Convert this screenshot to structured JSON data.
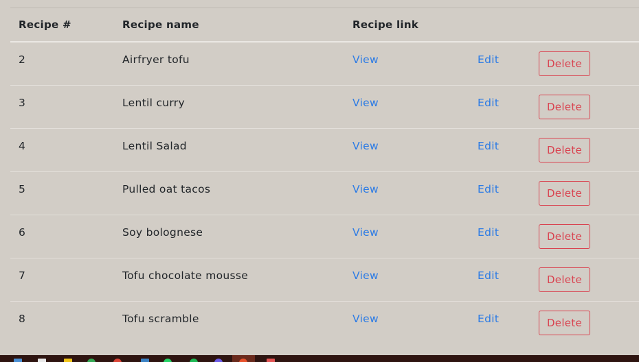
{
  "table": {
    "headers": {
      "number": "Recipe #",
      "name": "Recipe name",
      "link": "Recipe link"
    },
    "rows": [
      {
        "number": "2",
        "name": "Airfryer tofu",
        "view": "View",
        "edit": "Edit",
        "delete": "Delete"
      },
      {
        "number": "3",
        "name": "Lentil curry",
        "view": "View",
        "edit": "Edit",
        "delete": "Delete"
      },
      {
        "number": "4",
        "name": "Lentil Salad",
        "view": "View",
        "edit": "Edit",
        "delete": "Delete"
      },
      {
        "number": "5",
        "name": "Pulled oat tacos",
        "view": "View",
        "edit": "Edit",
        "delete": "Delete"
      },
      {
        "number": "6",
        "name": "Soy bolognese",
        "view": "View",
        "edit": "Edit",
        "delete": "Delete"
      },
      {
        "number": "7",
        "name": "Tofu chocolate mousse",
        "view": "View",
        "edit": "Edit",
        "delete": "Delete"
      },
      {
        "number": "8",
        "name": "Tofu scramble",
        "view": "View",
        "edit": "Edit",
        "delete": "Delete"
      }
    ]
  },
  "colors": {
    "background": "#d2cdc6",
    "link": "#2c7be5",
    "danger": "#d9424f",
    "taskbar": "#2e1410"
  },
  "taskbar": {
    "icons": [
      "start-icon",
      "file-icon",
      "warning-icon",
      "chrome-icon",
      "app-icon",
      "folder-icon",
      "whatsapp-icon",
      "spotify-icon",
      "app-icon",
      "browser-icon",
      "arrow-icon"
    ]
  }
}
